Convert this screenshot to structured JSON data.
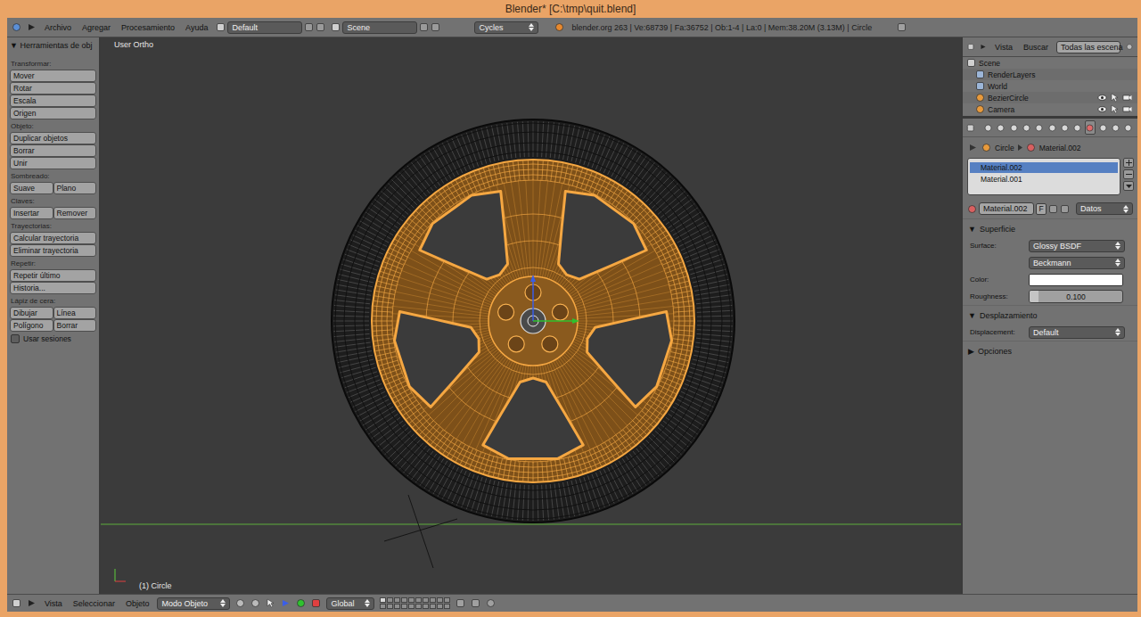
{
  "window": {
    "title": "Blender* [C:\\tmp\\quit.blend]"
  },
  "info_header": {
    "menus": [
      "Archivo",
      "Agregar",
      "Procesamiento",
      "Ayuda"
    ],
    "layout": "Default",
    "scene": "Scene",
    "engine": "Cycles",
    "stats": "blender.org 263 | Ve:68739 | Fa:36752 | Ob:1-4 | La:0 | Mem:38.20M (3.13M) | Circle"
  },
  "toolshelf": {
    "arrow": "▼",
    "title": "Herramientas de obj",
    "expanded": true,
    "groups": [
      {
        "label": "Transformar:",
        "rows": [
          [
            "Mover"
          ],
          [
            "Rotar"
          ],
          [
            "Escala"
          ],
          [
            "Origen"
          ]
        ]
      },
      {
        "label": "Objeto:",
        "rows": [
          [
            "Duplicar objetos"
          ],
          [
            "Borrar"
          ],
          [
            "Unir"
          ]
        ]
      },
      {
        "label": "Sombreado:",
        "rows": [
          [
            "Suave",
            "Plano"
          ]
        ]
      },
      {
        "label": "Claves:",
        "rows": [
          [
            "Insertar",
            "Remover"
          ]
        ]
      },
      {
        "label": "Trayectorias:",
        "rows": [
          [
            "Calcular trayectoria"
          ],
          [
            "Eliminar trayectoria"
          ]
        ]
      },
      {
        "label": "Repetir:",
        "rows": [
          [
            "Repetir último"
          ],
          [
            "Historia..."
          ]
        ]
      },
      {
        "label": "Lápiz de cera:",
        "rows": [
          [
            "Dibujar",
            "Línea"
          ],
          [
            "Polígono",
            "Borrar"
          ]
        ]
      }
    ],
    "checkbox": {
      "label": "Usar sesiones",
      "checked": false
    }
  },
  "viewport": {
    "view": "User Ortho",
    "object_label": "(1) Circle"
  },
  "outliner": {
    "menus": [
      "Vista",
      "Buscar"
    ],
    "filter": "Todas las escena",
    "items": [
      {
        "label": "Scene",
        "depth": 0,
        "kind": "scene"
      },
      {
        "label": "RenderLayers",
        "depth": 1,
        "kind": "data"
      },
      {
        "label": "World",
        "depth": 1,
        "kind": "data"
      },
      {
        "label": "BezierCircle",
        "depth": 1,
        "kind": "object"
      },
      {
        "label": "Camera",
        "depth": 1,
        "kind": "object"
      }
    ]
  },
  "properties": {
    "tabs": [
      {
        "selected": false
      },
      {
        "selected": false
      },
      {
        "selected": false
      },
      {
        "selected": false
      },
      {
        "selected": false
      },
      {
        "selected": false
      },
      {
        "selected": false
      },
      {
        "selected": false
      },
      {
        "selected": true
      },
      {
        "selected": false
      },
      {
        "selected": false
      },
      {
        "selected": false
      }
    ],
    "breadcrumb": [
      "Circle",
      "Material.002"
    ],
    "slots": [
      {
        "label": "Material.002",
        "selected": true
      },
      {
        "label": "Material.001",
        "selected": false
      }
    ],
    "material": {
      "name": "Material.002",
      "fake_user": "F",
      "link": "Datos"
    },
    "sections": [
      {
        "arrow": "▼",
        "title": "Superficie",
        "expanded": true,
        "fields": [
          {
            "kind": "dropdown",
            "label": "Surface:",
            "value": "Glossy BSDF"
          },
          {
            "kind": "dropdown",
            "value": "Beckmann"
          },
          {
            "kind": "color",
            "label": "Color:",
            "color": "#ffffff"
          },
          {
            "kind": "slider",
            "label": "Roughness:",
            "value": "0.100",
            "level": 0.1
          }
        ]
      },
      {
        "arrow": "▼",
        "title": "Desplazamiento",
        "expanded": true,
        "fields": [
          {
            "kind": "dropdown",
            "label": "Displacement:",
            "value": "Default"
          }
        ]
      },
      {
        "arrow": "▶",
        "title": "Opciones",
        "expanded": false,
        "fields": []
      }
    ]
  },
  "bottom_header": {
    "menus": [
      "Vista",
      "Seleccionar",
      "Objeto"
    ],
    "mode": "Modo Objeto",
    "orientation": "Global",
    "layers": [
      {
        "selected": true
      },
      {
        "selected": false
      },
      {
        "selected": false
      },
      {
        "selected": false
      },
      {
        "selected": false
      },
      {
        "selected": false
      },
      {
        "selected": false
      },
      {
        "selected": false
      },
      {
        "selected": false
      },
      {
        "selected": false
      },
      {
        "selected": false
      },
      {
        "selected": false
      },
      {
        "selected": false
      },
      {
        "selected": false
      },
      {
        "selected": false
      },
      {
        "selected": false
      },
      {
        "selected": false
      },
      {
        "selected": false
      },
      {
        "selected": false
      },
      {
        "selected": false
      }
    ]
  }
}
